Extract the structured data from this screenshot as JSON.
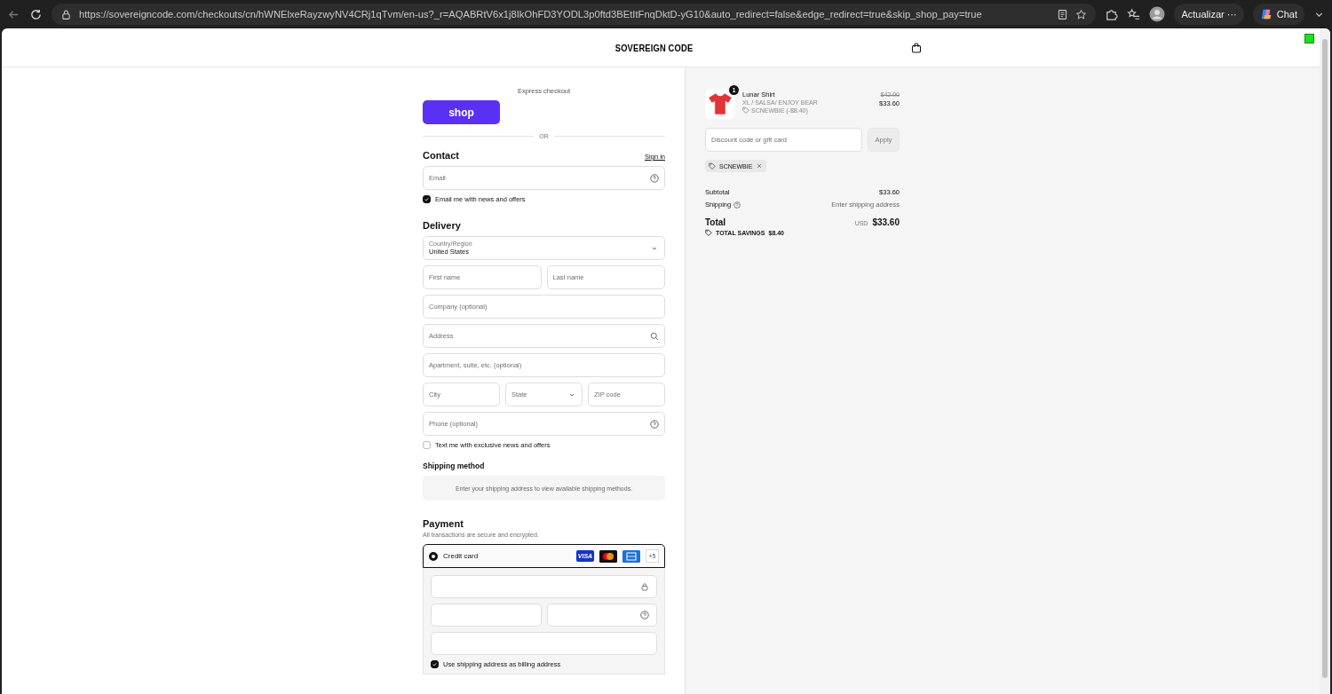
{
  "browser": {
    "url": "https://sovereigncode.com/checkouts/cn/hWNElxeRayzwyNV4CRj1qTvm/en-us?_r=AQABRtV6x1j8IkOhFD3YODL3p0ftd3BEtItFnqDktD-yG10&auto_redirect=false&edge_redirect=true&skip_shop_pay=true",
    "update_label": "Actualizar",
    "more_label": "···",
    "chat_label": "Chat"
  },
  "header": {
    "brand": "SOVEREIGN CODE"
  },
  "express": {
    "label": "Express checkout",
    "shop_button": "shop",
    "or_label": "OR"
  },
  "contact": {
    "title": "Contact",
    "sign_in": "Sign in",
    "email": {
      "placeholder": "Email",
      "kind": "help"
    },
    "news": {
      "label": "Email me with news and offers",
      "checked": true
    }
  },
  "delivery": {
    "title": "Delivery",
    "country": {
      "label": "Country/Region",
      "value": "United States"
    },
    "rows": [
      [
        {
          "placeholder": "First name",
          "kind": "text"
        },
        {
          "placeholder": "Last name",
          "kind": "text"
        }
      ],
      [
        {
          "placeholder": "Company (optional)",
          "kind": "text"
        }
      ],
      [
        {
          "placeholder": "Address",
          "kind": "search"
        }
      ],
      [
        {
          "placeholder": "Apartment, suite, etc. (optional)",
          "kind": "text"
        }
      ],
      [
        {
          "placeholder": "City",
          "kind": "text"
        },
        {
          "placeholder": "State",
          "kind": "select"
        },
        {
          "placeholder": "ZIP code",
          "kind": "text"
        }
      ],
      [
        {
          "placeholder": "Phone (optional)",
          "kind": "help"
        }
      ]
    ],
    "sms": {
      "label": "Text me with exclusive news and offers",
      "checked": false
    }
  },
  "shipping_method": {
    "title": "Shipping method",
    "message": "Enter your shipping address to view available shipping methods."
  },
  "payment": {
    "title": "Payment",
    "subtitle": "All transactions are secure and encrypted.",
    "method": {
      "label": "Credit card",
      "selected": true
    },
    "visa": "VISA",
    "more_cards": "+5",
    "card_fields": [
      {
        "kind": "secure"
      },
      {
        "kind": "plain"
      },
      {
        "kind": "help"
      },
      {
        "kind": "plain"
      }
    ],
    "billing": {
      "label": "Use shipping address as billing address",
      "checked": true
    }
  },
  "summary": {
    "item": {
      "quantity": "1",
      "name": "Lunar Shirt",
      "variant": "XL / SALSA/ ENJOY BEAR",
      "discount": "SCNEWBIE (-$8.40)",
      "original_price": "$42.00",
      "price": "$33.60"
    },
    "discount_placeholder": "Discount code or gift card",
    "apply": "Apply",
    "applied_code": "SCNEWBIE",
    "subtotal_label": "Subtotal",
    "subtotal": "$33.60",
    "shipping_label": "Shipping",
    "shipping": "Enter shipping address",
    "total_label": "Total",
    "currency": "USD",
    "total": "$33.60",
    "savings_label": "TOTAL SAVINGS",
    "savings": "$8.40"
  }
}
